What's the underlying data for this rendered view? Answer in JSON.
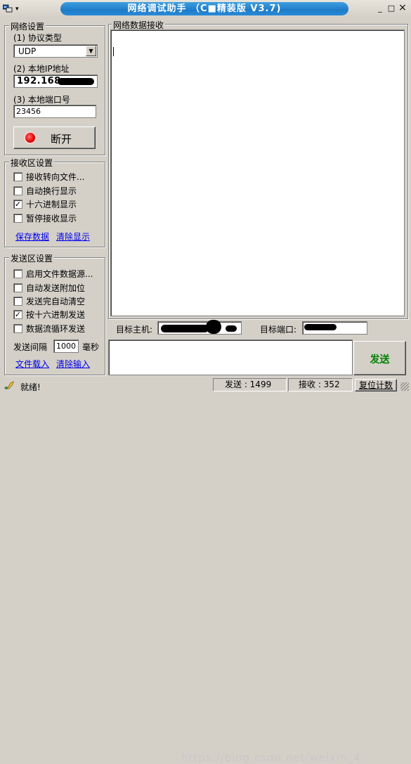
{
  "titlebar": {
    "title": "网络调试助手 （C■精装版 V3.7)",
    "minimize": "_",
    "maximize": "□",
    "close": "×",
    "menu_arrow": "▾"
  },
  "network": {
    "group_label": "网络设置",
    "protocol_label": "(1) 协议类型",
    "protocol_value": "UDP",
    "local_ip_label": "(2) 本地IP地址",
    "local_ip_value": "192.168",
    "local_port_label": "(3) 本地端口号",
    "local_port_value": "23456",
    "disconnect_label": "断开",
    "status_color": "#ff0000"
  },
  "receive": {
    "group_label": "接收区设置",
    "options": [
      {
        "label": "接收转向文件...",
        "checked": false
      },
      {
        "label": "自动换行显示",
        "checked": false
      },
      {
        "label": "十六进制显示",
        "checked": true
      },
      {
        "label": "暂停接收显示",
        "checked": false
      }
    ],
    "save_data": "保存数据",
    "clear_display": "清除显示"
  },
  "send": {
    "group_label": "发送区设置",
    "options": [
      {
        "label": "启用文件数据源...",
        "checked": false
      },
      {
        "label": "自动发送附加位",
        "checked": false
      },
      {
        "label": "发送完自动清空",
        "checked": false
      },
      {
        "label": "按十六进制发送",
        "checked": true
      },
      {
        "label": "数据流循环发送",
        "checked": false
      }
    ],
    "interval_label": "发送间隔",
    "interval_value": "1000",
    "interval_unit": "毫秒",
    "load_file": "文件载入",
    "clear_input": "清除输入"
  },
  "data_panel": {
    "group_label": "网络数据接收",
    "target_host_label": "目标主机:",
    "target_port_label": "目标端口:",
    "send_button": "发送",
    "send_button_color": "#008000"
  },
  "statusbar": {
    "ready": "就绪!",
    "sent_label": "发送 : 1499",
    "received_label": "接收 : 352",
    "reset_counts": "复位计数",
    "watermark": "https://blog.csdn.net/weixin_4"
  }
}
